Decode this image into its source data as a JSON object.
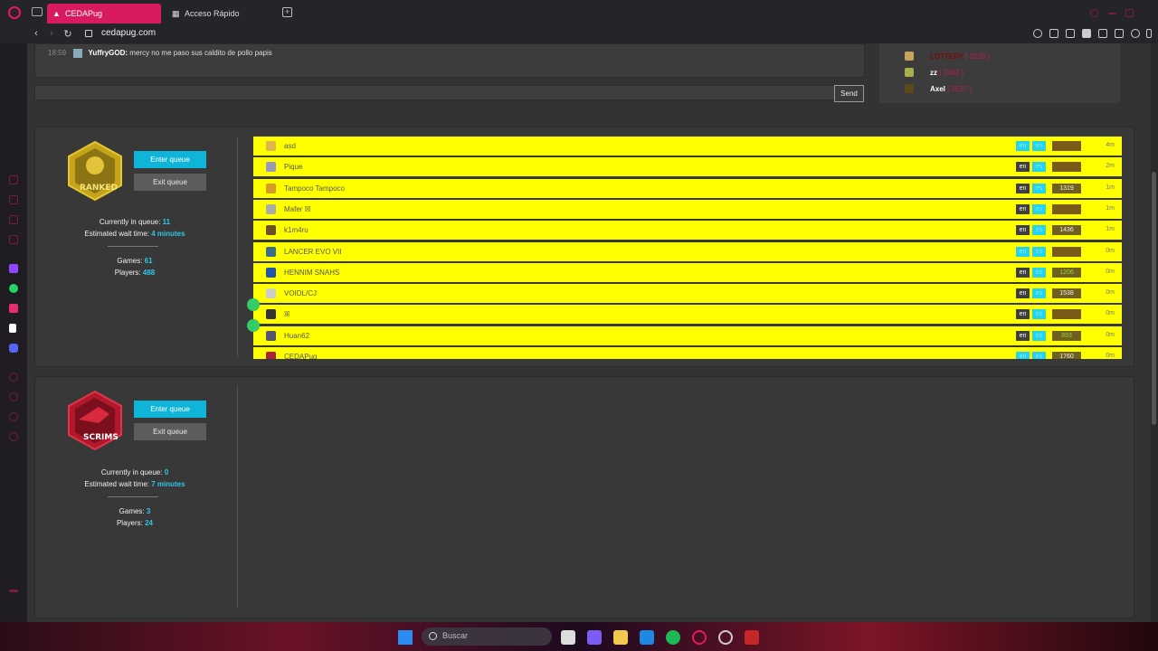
{
  "browser": {
    "tabs": [
      {
        "label": "CEDAPug",
        "active": true,
        "icon": "cedapug-tab-icon"
      },
      {
        "label": "Acceso Rápido",
        "active": false,
        "icon": "grid-icon"
      }
    ],
    "url": "cedapug.com"
  },
  "chat": {
    "time": "18:59",
    "user": "YuffryGOD:",
    "message": "mercy no me paso sus caldito de pollo papis",
    "send_label": "Send"
  },
  "online_users": [
    {
      "name": "LOTTERY",
      "rank": "[ 3226 ]",
      "muted": true
    },
    {
      "name": "zz",
      "rank": "[ 2432 ]",
      "muted": false
    },
    {
      "name": "Axel",
      "rank": "[ 2537 ]",
      "muted": false
    }
  ],
  "ranked": {
    "badge_label": "RANKED",
    "enter_label": "Enter queue",
    "exit_label": "Exit queue",
    "in_queue_label": "Currently in queue:",
    "in_queue_value": "11",
    "wait_label": "Estimated wait time:",
    "wait_value": "4 minutes",
    "games_label": "Games:",
    "games_value": "61",
    "players_label": "Players:",
    "players_value": "488",
    "queue": [
      {
        "name": "asd",
        "en": false,
        "elo": "",
        "time": "4m",
        "av": "#e0b64a"
      },
      {
        "name": "Pique",
        "en": true,
        "elo": "",
        "time": "2m",
        "av": "#9999bb"
      },
      {
        "name": "Tampoco Tampoco",
        "en": true,
        "elo": "1319",
        "time": "1m",
        "av": "#d49a2a"
      },
      {
        "name": "Mafer ☒",
        "en": true,
        "elo": "",
        "time": "1m",
        "av": "#aaaaaa"
      },
      {
        "name": "k1m4ru",
        "en": true,
        "elo": "1436",
        "time": "1m",
        "av": "#6b4f2a"
      },
      {
        "name": "LANCER EVO VII",
        "en": false,
        "elo": "",
        "time": "0m",
        "av": "#3a6f8c"
      },
      {
        "name": "HENNIM SNAHS",
        "en": true,
        "elo": "1206",
        "time": "0m",
        "av": "#2255aa"
      },
      {
        "name": "VOIDL/CJ",
        "en": true,
        "elo": "1538",
        "time": "0m",
        "av": "#cccccc"
      },
      {
        "name": "ꕤ",
        "en": true,
        "elo": "",
        "time": "0m",
        "av": "#333333"
      },
      {
        "name": "Huan62",
        "en": true,
        "elo": "893",
        "time": "0m",
        "av": "#555577"
      },
      {
        "name": "CEDAPug",
        "en": false,
        "elo": "1760",
        "time": "0m",
        "av": "#aa2233"
      }
    ]
  },
  "scrims": {
    "badge_label": "SCRIMS",
    "enter_label": "Enter queue",
    "exit_label": "Exit queue",
    "in_queue_label": "Currently in queue:",
    "in_queue_value": "0",
    "wait_label": "Estimated wait time:",
    "wait_value": "7 minutes",
    "games_label": "Games:",
    "games_value": "3",
    "players_label": "Players:",
    "players_value": "24"
  },
  "taskbar": {
    "search_placeholder": "Buscar"
  }
}
